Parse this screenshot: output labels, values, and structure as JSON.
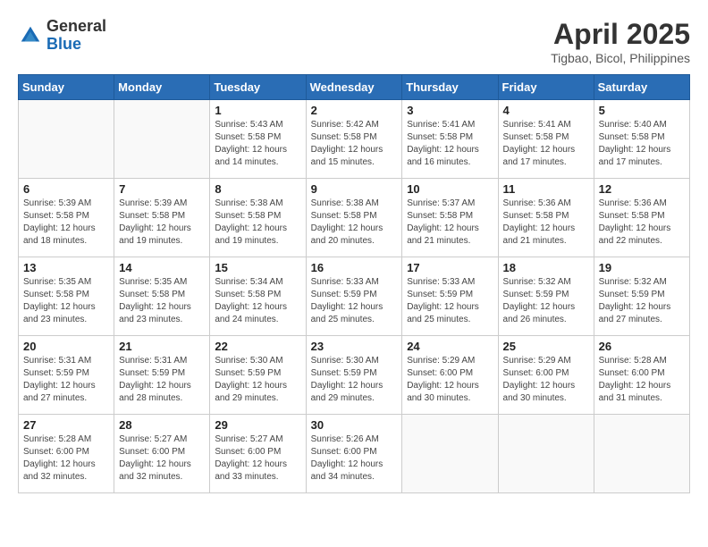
{
  "logo": {
    "general": "General",
    "blue": "Blue"
  },
  "title": {
    "month_year": "April 2025",
    "location": "Tigbao, Bicol, Philippines"
  },
  "headers": [
    "Sunday",
    "Monday",
    "Tuesday",
    "Wednesday",
    "Thursday",
    "Friday",
    "Saturday"
  ],
  "weeks": [
    [
      {
        "day": "",
        "detail": ""
      },
      {
        "day": "",
        "detail": ""
      },
      {
        "day": "1",
        "detail": "Sunrise: 5:43 AM\nSunset: 5:58 PM\nDaylight: 12 hours\nand 14 minutes."
      },
      {
        "day": "2",
        "detail": "Sunrise: 5:42 AM\nSunset: 5:58 PM\nDaylight: 12 hours\nand 15 minutes."
      },
      {
        "day": "3",
        "detail": "Sunrise: 5:41 AM\nSunset: 5:58 PM\nDaylight: 12 hours\nand 16 minutes."
      },
      {
        "day": "4",
        "detail": "Sunrise: 5:41 AM\nSunset: 5:58 PM\nDaylight: 12 hours\nand 17 minutes."
      },
      {
        "day": "5",
        "detail": "Sunrise: 5:40 AM\nSunset: 5:58 PM\nDaylight: 12 hours\nand 17 minutes."
      }
    ],
    [
      {
        "day": "6",
        "detail": "Sunrise: 5:39 AM\nSunset: 5:58 PM\nDaylight: 12 hours\nand 18 minutes."
      },
      {
        "day": "7",
        "detail": "Sunrise: 5:39 AM\nSunset: 5:58 PM\nDaylight: 12 hours\nand 19 minutes."
      },
      {
        "day": "8",
        "detail": "Sunrise: 5:38 AM\nSunset: 5:58 PM\nDaylight: 12 hours\nand 19 minutes."
      },
      {
        "day": "9",
        "detail": "Sunrise: 5:38 AM\nSunset: 5:58 PM\nDaylight: 12 hours\nand 20 minutes."
      },
      {
        "day": "10",
        "detail": "Sunrise: 5:37 AM\nSunset: 5:58 PM\nDaylight: 12 hours\nand 21 minutes."
      },
      {
        "day": "11",
        "detail": "Sunrise: 5:36 AM\nSunset: 5:58 PM\nDaylight: 12 hours\nand 21 minutes."
      },
      {
        "day": "12",
        "detail": "Sunrise: 5:36 AM\nSunset: 5:58 PM\nDaylight: 12 hours\nand 22 minutes."
      }
    ],
    [
      {
        "day": "13",
        "detail": "Sunrise: 5:35 AM\nSunset: 5:58 PM\nDaylight: 12 hours\nand 23 minutes."
      },
      {
        "day": "14",
        "detail": "Sunrise: 5:35 AM\nSunset: 5:58 PM\nDaylight: 12 hours\nand 23 minutes."
      },
      {
        "day": "15",
        "detail": "Sunrise: 5:34 AM\nSunset: 5:58 PM\nDaylight: 12 hours\nand 24 minutes."
      },
      {
        "day": "16",
        "detail": "Sunrise: 5:33 AM\nSunset: 5:59 PM\nDaylight: 12 hours\nand 25 minutes."
      },
      {
        "day": "17",
        "detail": "Sunrise: 5:33 AM\nSunset: 5:59 PM\nDaylight: 12 hours\nand 25 minutes."
      },
      {
        "day": "18",
        "detail": "Sunrise: 5:32 AM\nSunset: 5:59 PM\nDaylight: 12 hours\nand 26 minutes."
      },
      {
        "day": "19",
        "detail": "Sunrise: 5:32 AM\nSunset: 5:59 PM\nDaylight: 12 hours\nand 27 minutes."
      }
    ],
    [
      {
        "day": "20",
        "detail": "Sunrise: 5:31 AM\nSunset: 5:59 PM\nDaylight: 12 hours\nand 27 minutes."
      },
      {
        "day": "21",
        "detail": "Sunrise: 5:31 AM\nSunset: 5:59 PM\nDaylight: 12 hours\nand 28 minutes."
      },
      {
        "day": "22",
        "detail": "Sunrise: 5:30 AM\nSunset: 5:59 PM\nDaylight: 12 hours\nand 29 minutes."
      },
      {
        "day": "23",
        "detail": "Sunrise: 5:30 AM\nSunset: 5:59 PM\nDaylight: 12 hours\nand 29 minutes."
      },
      {
        "day": "24",
        "detail": "Sunrise: 5:29 AM\nSunset: 6:00 PM\nDaylight: 12 hours\nand 30 minutes."
      },
      {
        "day": "25",
        "detail": "Sunrise: 5:29 AM\nSunset: 6:00 PM\nDaylight: 12 hours\nand 30 minutes."
      },
      {
        "day": "26",
        "detail": "Sunrise: 5:28 AM\nSunset: 6:00 PM\nDaylight: 12 hours\nand 31 minutes."
      }
    ],
    [
      {
        "day": "27",
        "detail": "Sunrise: 5:28 AM\nSunset: 6:00 PM\nDaylight: 12 hours\nand 32 minutes."
      },
      {
        "day": "28",
        "detail": "Sunrise: 5:27 AM\nSunset: 6:00 PM\nDaylight: 12 hours\nand 32 minutes."
      },
      {
        "day": "29",
        "detail": "Sunrise: 5:27 AM\nSunset: 6:00 PM\nDaylight: 12 hours\nand 33 minutes."
      },
      {
        "day": "30",
        "detail": "Sunrise: 5:26 AM\nSunset: 6:00 PM\nDaylight: 12 hours\nand 34 minutes."
      },
      {
        "day": "",
        "detail": ""
      },
      {
        "day": "",
        "detail": ""
      },
      {
        "day": "",
        "detail": ""
      }
    ]
  ]
}
